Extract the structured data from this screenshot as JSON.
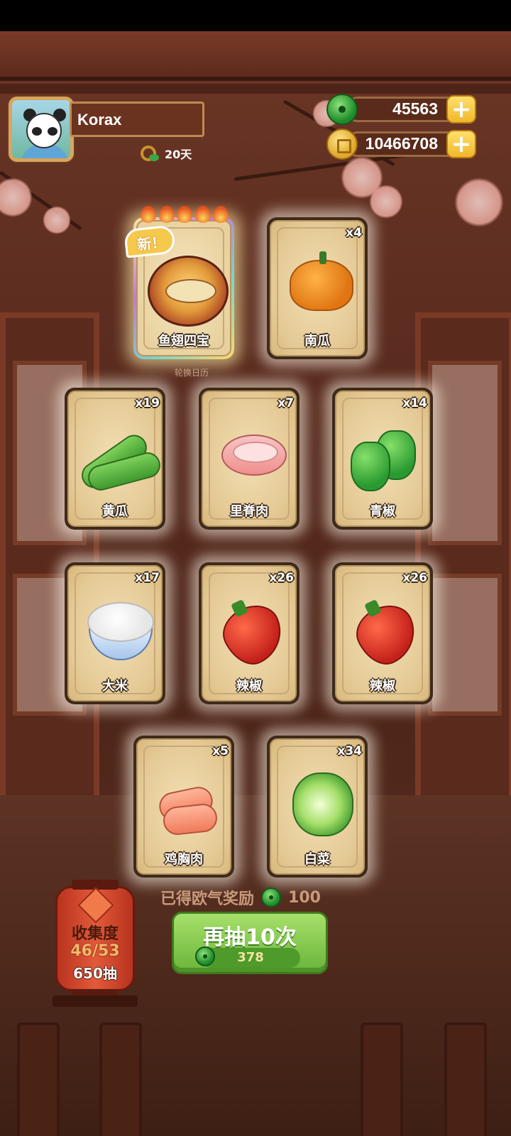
{
  "player": {
    "name": "Korax",
    "days": "20天"
  },
  "currency": {
    "jade": "45563",
    "coins": "10466708"
  },
  "featured_card": {
    "badge": "新！",
    "name": "鱼翅四宝",
    "caption": "轮换日历"
  },
  "cards": [
    {
      "name": "南瓜",
      "count": "x4",
      "icon": "pumpkin-icon"
    },
    {
      "name": "黄瓜",
      "count": "x19",
      "icon": "cucumber-icon"
    },
    {
      "name": "里脊肉",
      "count": "x7",
      "icon": "pork-loin-icon"
    },
    {
      "name": "青椒",
      "count": "x14",
      "icon": "green-pepper-icon"
    },
    {
      "name": "大米",
      "count": "x17",
      "icon": "rice-bowl-icon"
    },
    {
      "name": "辣椒",
      "count": "x26",
      "icon": "chili-icon"
    },
    {
      "name": "辣椒",
      "count": "x26",
      "icon": "chili-icon"
    },
    {
      "name": "鸡胸肉",
      "count": "x5",
      "icon": "chicken-breast-icon"
    },
    {
      "name": "白菜",
      "count": "x34",
      "icon": "cabbage-icon"
    }
  ],
  "luck_reward": {
    "label": "已得欧气奖励",
    "value": "100"
  },
  "draw_button": {
    "label": "再抽10次",
    "cost": "378"
  },
  "collection": {
    "title": "收集度",
    "progress": "46/53",
    "draws": "650抽"
  },
  "colors": {
    "draw_button": "#7cc447",
    "lantern": "#d9452a",
    "card_bg": "#e8d2a0"
  }
}
